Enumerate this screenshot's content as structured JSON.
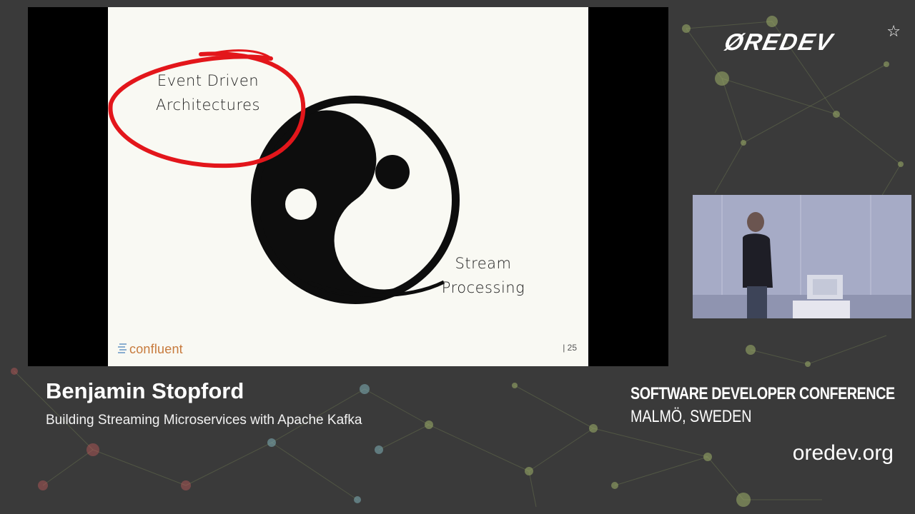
{
  "slide": {
    "label_event_driven_line1": "Event Driven",
    "label_event_driven_line2": "Architectures",
    "label_stream_line1": "Stream",
    "label_stream_line2": "Processing",
    "brand": "confluent",
    "page_number": "| 25"
  },
  "logo": {
    "text": "ØREDEV",
    "star": "☆"
  },
  "speaker": {
    "name": "Benjamin Stopford",
    "talk_title": "Building Streaming Microservices with Apache Kafka"
  },
  "conference": {
    "name": "SOFTWARE DEVELOPER  CONFERENCE",
    "location": "MALMÖ, SWEDEN",
    "website": "oredev.org"
  },
  "colors": {
    "background": "#3a3a3a",
    "slide_bg": "#f9f9f3",
    "circle_red": "#e3161b",
    "brand_orange": "#c77a3c"
  }
}
